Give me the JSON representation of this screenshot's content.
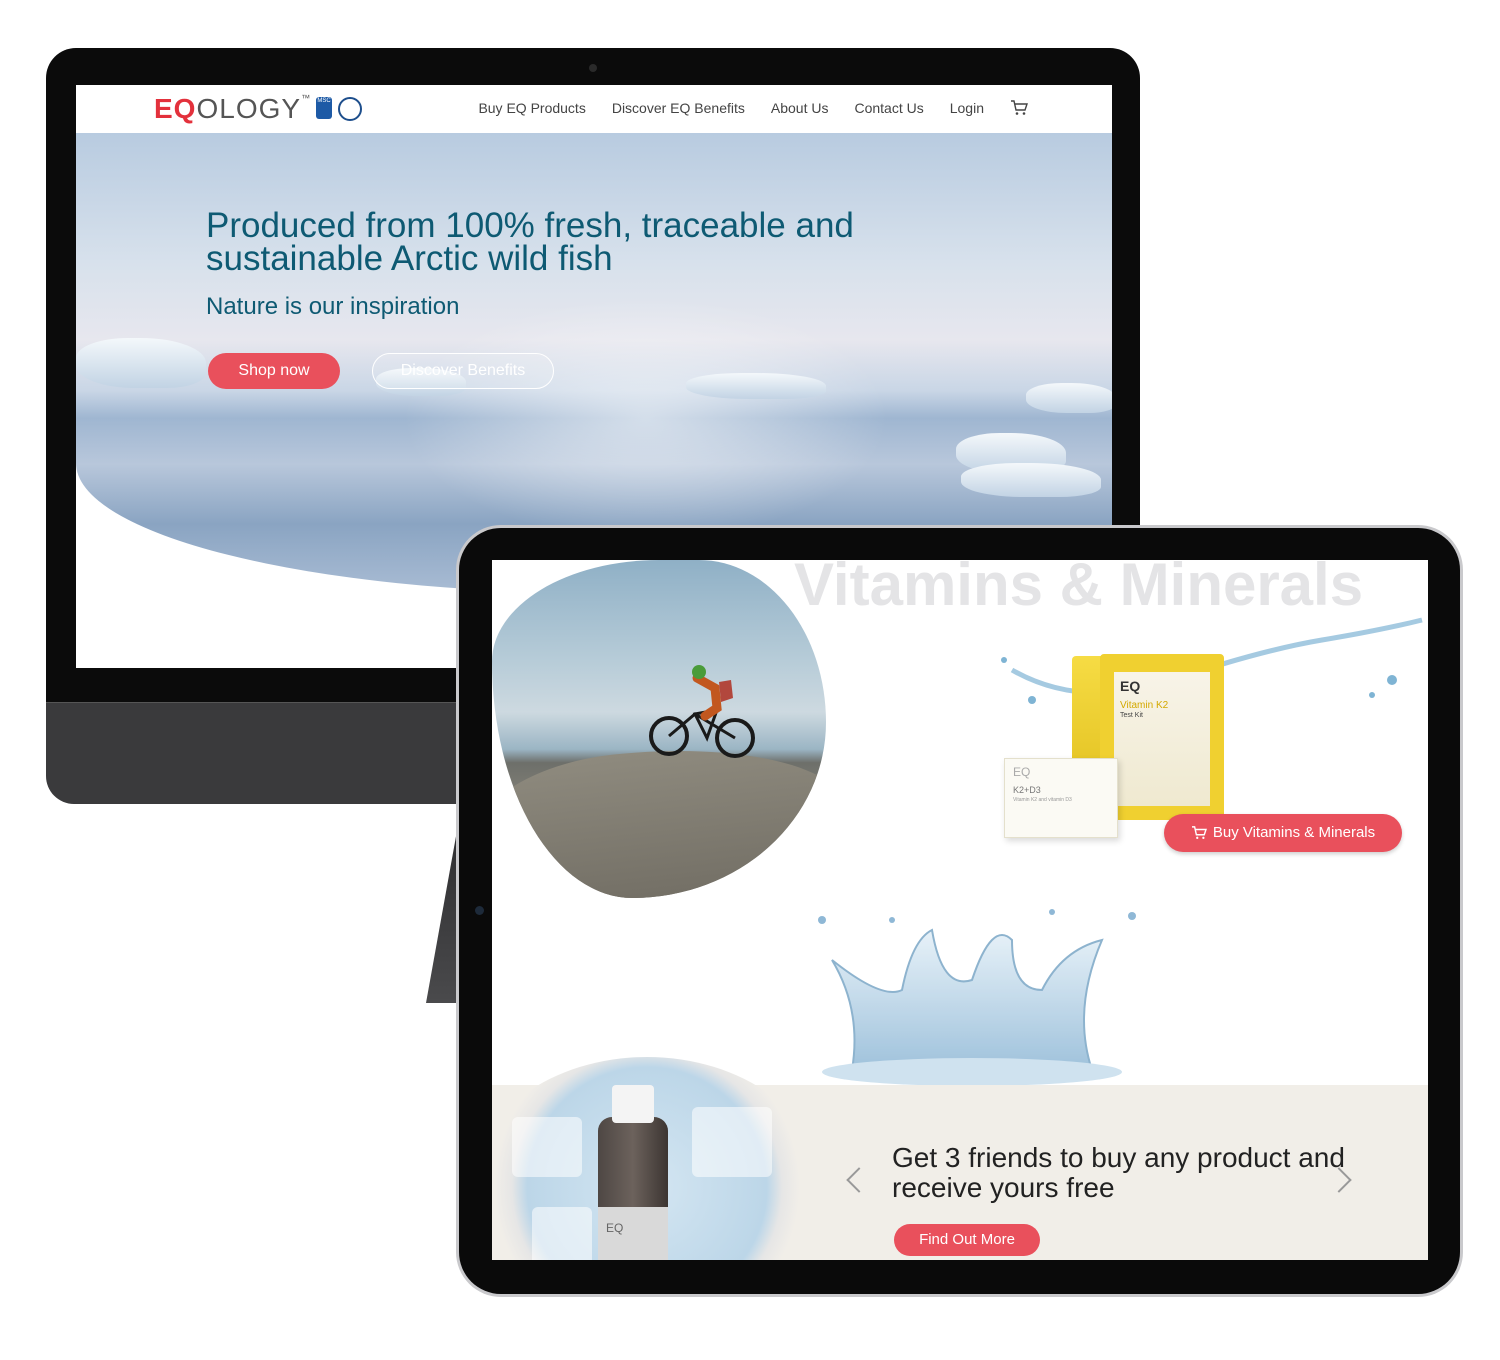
{
  "desktop": {
    "logo": {
      "mark": "EQ",
      "rest": "OLOGY",
      "tm": "™",
      "msc_badge": "MSC"
    },
    "nav": [
      "Buy EQ Products",
      "Discover EQ Benefits",
      "About Us",
      "Contact Us",
      "Login"
    ],
    "hero": {
      "title": "Produced from 100% fresh, traceable and sustainable Arctic wild fish",
      "subtitle": "Nature is our inspiration",
      "primary_button": "Shop now",
      "secondary_button": "Discover Benefits"
    }
  },
  "tablet": {
    "watermark": "Vitamins & Minerals",
    "product_pouch": {
      "brand": "EQ",
      "name": "Vitamin K2",
      "sub": "Test Kit"
    },
    "product_box": {
      "brand": "EQ",
      "name": "K2+D3",
      "sub": "Vitamin K2 and vitamin D3"
    },
    "buy_button": "Buy Vitamins & Minerals",
    "bottle_brand": "EQ",
    "promo": {
      "text": "Get 3 friends to buy any product and receive yours free",
      "button": "Find Out More"
    }
  },
  "colors": {
    "accent": "#e9505c",
    "brand_red": "#e3313c",
    "hero_text": "#0e5a73"
  }
}
